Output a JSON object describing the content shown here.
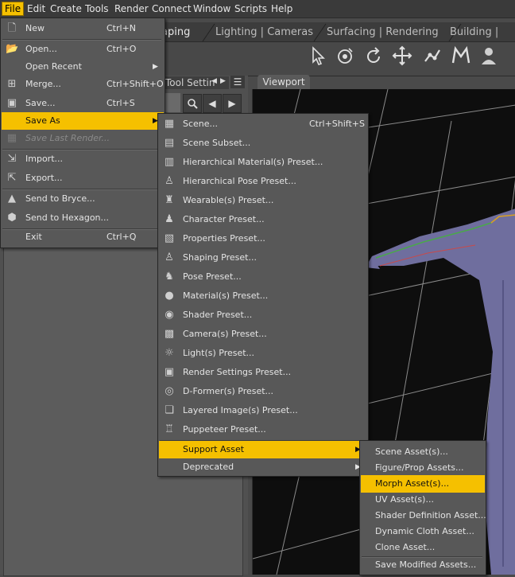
{
  "menubar": [
    "File",
    "Edit",
    "Create",
    "Tools",
    "Render",
    "Connect",
    "Window",
    "Scripts",
    "Help"
  ],
  "tabs": [
    "aping",
    "Lighting | Cameras",
    "Surfacing | Rendering",
    "Building | Scri"
  ],
  "panels": {
    "tool_settings": "Tool Settin",
    "viewport": "Viewport"
  },
  "icons": {
    "toolbar": [
      "pointer-icon",
      "universal-rotate-icon",
      "rotate-icon",
      "translate-icon",
      "joint-editor-icon",
      "morph-icon",
      "figure-icon"
    ],
    "nav": [
      "magnify-icon",
      "back-arrow-icon",
      "forward-arrow-icon"
    ]
  },
  "file_menu": [
    {
      "label": "New",
      "shortcut": "Ctrl+N",
      "icon": "new-file-icon"
    },
    {
      "label": "Open...",
      "shortcut": "Ctrl+O",
      "icon": "open-folder-icon"
    },
    {
      "label": "Open Recent",
      "submenu": true
    },
    {
      "label": "Merge...",
      "shortcut": "Ctrl+Shift+O",
      "icon": "merge-icon"
    },
    {
      "label": "Save...",
      "shortcut": "Ctrl+S",
      "icon": "save-icon"
    },
    {
      "label": "Save As",
      "submenu": true,
      "highlighted": true
    },
    {
      "label": "Save Last Render...",
      "disabled": true,
      "icon": "render-icon"
    },
    {
      "label": "Import...",
      "icon": "import-icon"
    },
    {
      "label": "Export...",
      "icon": "export-icon"
    },
    {
      "label": "Send to Bryce...",
      "icon": "bryce-icon"
    },
    {
      "label": "Send to Hexagon...",
      "icon": "hexagon-icon"
    },
    {
      "label": "Exit",
      "shortcut": "Ctrl+Q"
    }
  ],
  "save_as_menu": [
    {
      "label": "Scene...",
      "shortcut": "Ctrl+Shift+S"
    },
    {
      "label": "Scene Subset..."
    },
    {
      "label": "Hierarchical Material(s) Preset..."
    },
    {
      "label": "Hierarchical Pose Preset..."
    },
    {
      "label": "Wearable(s) Preset..."
    },
    {
      "label": "Character Preset..."
    },
    {
      "label": "Properties Preset..."
    },
    {
      "label": "Shaping Preset..."
    },
    {
      "label": "Pose Preset..."
    },
    {
      "label": "Material(s) Preset..."
    },
    {
      "label": "Shader Preset..."
    },
    {
      "label": "Camera(s) Preset..."
    },
    {
      "label": "Light(s) Preset..."
    },
    {
      "label": "Render Settings Preset..."
    },
    {
      "label": "D-Former(s) Preset..."
    },
    {
      "label": "Layered Image(s) Preset..."
    },
    {
      "label": "Puppeteer Preset..."
    },
    {
      "label": "Support Asset",
      "submenu": true,
      "highlighted": true
    },
    {
      "label": "Deprecated",
      "submenu": true
    }
  ],
  "support_asset_menu": [
    {
      "label": "Scene Asset(s)..."
    },
    {
      "label": "Figure/Prop Assets..."
    },
    {
      "label": "Morph Asset(s)...",
      "highlighted": true
    },
    {
      "label": "UV Asset(s)..."
    },
    {
      "label": "Shader Definition Asset..."
    },
    {
      "label": "Dynamic Cloth Asset..."
    },
    {
      "label": "Clone Asset..."
    },
    {
      "label": "Save Modified Assets..."
    }
  ],
  "colors": {
    "highlight": "#f5c000",
    "menu_bg": "#585858",
    "viewport_bg": "#0e0e0e",
    "figure": "#6f6e9e"
  }
}
